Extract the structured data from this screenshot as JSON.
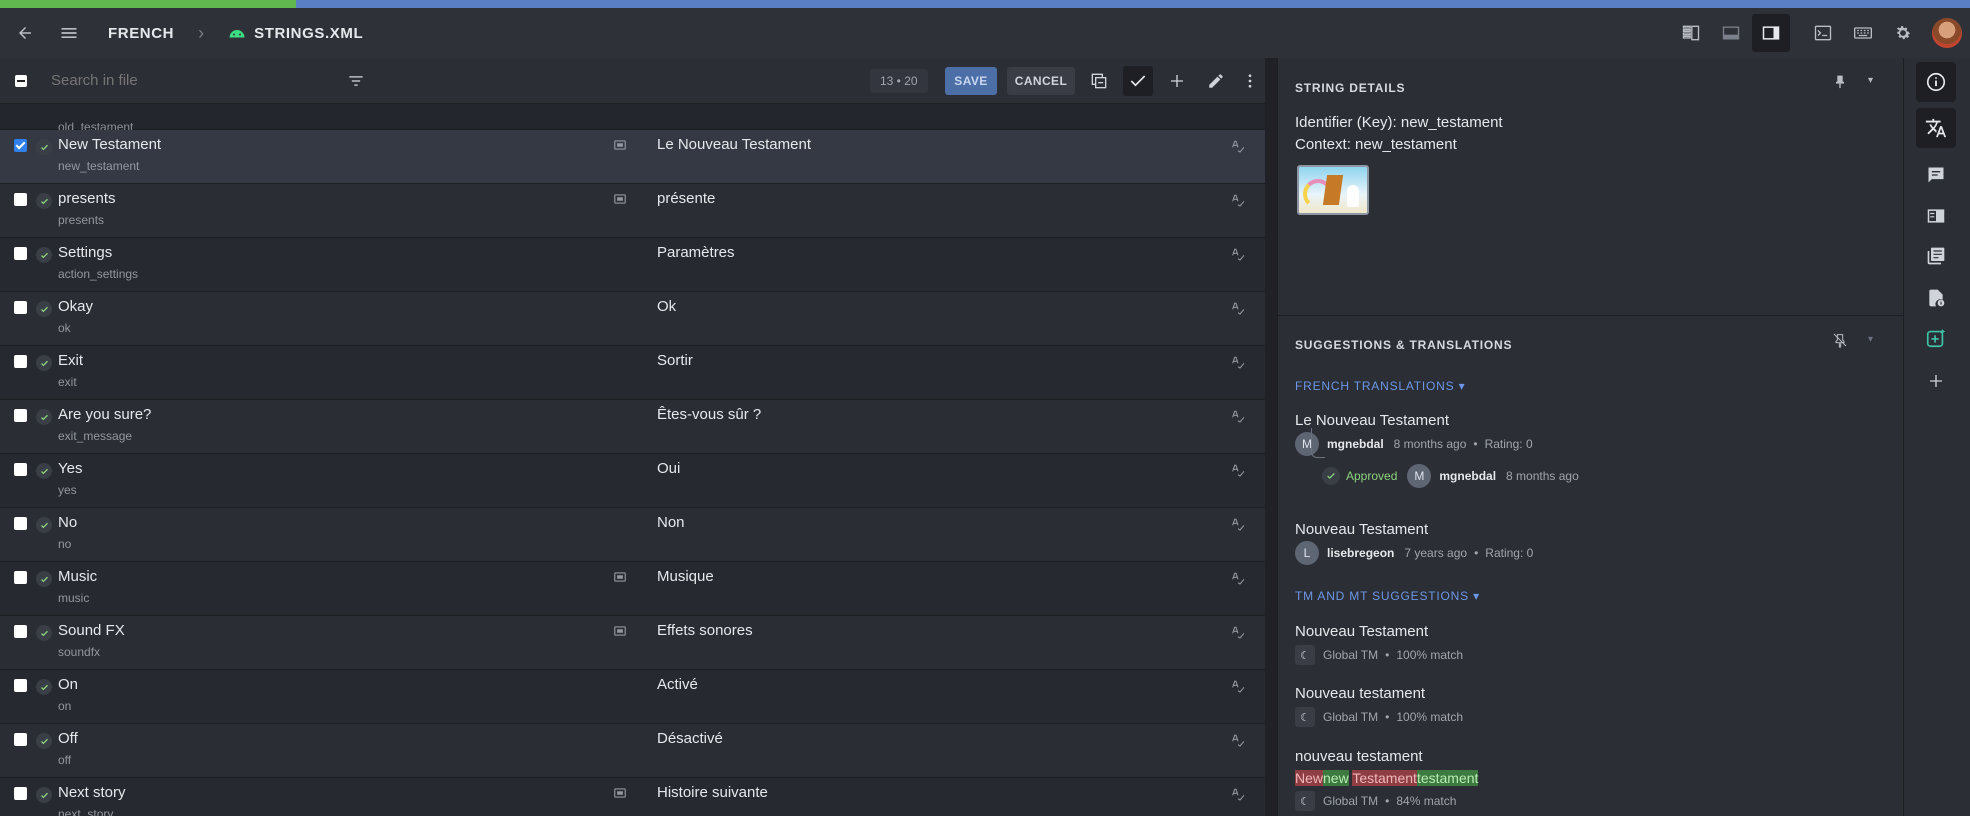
{
  "header": {
    "project": "FRENCH",
    "file": "STRINGS.XML"
  },
  "progress": {
    "translated_fraction": 0.15
  },
  "toolbar": {
    "search_placeholder": "Search in file",
    "pager": "13 • 20",
    "save_label": "SAVE",
    "cancel_label": "CANCEL"
  },
  "list": {
    "peek_key": "old_testament",
    "rows": [
      {
        "source": "New Testament",
        "key": "new_testament",
        "translation": "Le Nouveau Testament",
        "screenshot": true,
        "selected": true
      },
      {
        "source": "presents",
        "key": "presents",
        "translation": "présente",
        "screenshot": true,
        "selected": false
      },
      {
        "source": "Settings",
        "key": "action_settings",
        "translation": "Paramètres",
        "screenshot": false,
        "selected": false
      },
      {
        "source": "Okay",
        "key": "ok",
        "translation": "Ok",
        "screenshot": false,
        "selected": false
      },
      {
        "source": "Exit",
        "key": "exit",
        "translation": "Sortir",
        "screenshot": false,
        "selected": false
      },
      {
        "source": "Are you sure?",
        "key": "exit_message",
        "translation": "Êtes-vous sûr ?",
        "screenshot": false,
        "selected": false
      },
      {
        "source": "Yes",
        "key": "yes",
        "translation": "Oui",
        "screenshot": false,
        "selected": false
      },
      {
        "source": "No",
        "key": "no",
        "translation": "Non",
        "screenshot": false,
        "selected": false
      },
      {
        "source": "Music",
        "key": "music",
        "translation": "Musique",
        "screenshot": true,
        "selected": false
      },
      {
        "source": "Sound FX",
        "key": "soundfx",
        "translation": "Effets sonores",
        "screenshot": true,
        "selected": false
      },
      {
        "source": "On",
        "key": "on",
        "translation": "Activé",
        "screenshot": false,
        "selected": false
      },
      {
        "source": "Off",
        "key": "off",
        "translation": "Désactivé",
        "screenshot": false,
        "selected": false
      },
      {
        "source": "Next story",
        "key": "next_story",
        "translation": "Histoire suivante",
        "screenshot": true,
        "selected": false
      }
    ]
  },
  "details": {
    "title": "STRING DETAILS",
    "identifier": "Identifier (Key): new_testament",
    "context": "Context: new_testament"
  },
  "suggestions": {
    "title": "SUGGESTIONS & TRANSLATIONS",
    "french_header": "FRENCH TRANSLATIONS",
    "translations": [
      {
        "text": "Le Nouveau Testament",
        "avatar": "M",
        "user": "mgnebdal",
        "time": "8 months ago",
        "rating": "Rating: 0"
      },
      {
        "text": "Nouveau Testament",
        "avatar": "L",
        "user": "lisebregeon",
        "time": "7 years ago",
        "rating": "Rating: 0"
      }
    ],
    "approval": {
      "label": "Approved",
      "avatar": "M",
      "user": "mgnebdal",
      "time": "8 months ago"
    },
    "tm_header": "TM AND MT SUGGESTIONS",
    "tm": [
      {
        "text": "Nouveau Testament",
        "source": "Global TM",
        "match": "100% match"
      },
      {
        "text": "Nouveau testament",
        "source": "Global TM",
        "match": "100% match"
      },
      {
        "text": "nouveau testament",
        "source": "Global TM",
        "match": "84% match"
      }
    ],
    "diff": [
      {
        "t": "New",
        "k": "del"
      },
      {
        "t": "new",
        "k": "ins"
      },
      {
        "t": " ",
        "k": "same"
      },
      {
        "t": "Testament",
        "k": "del"
      },
      {
        "t": "testament",
        "k": "ins"
      }
    ]
  }
}
